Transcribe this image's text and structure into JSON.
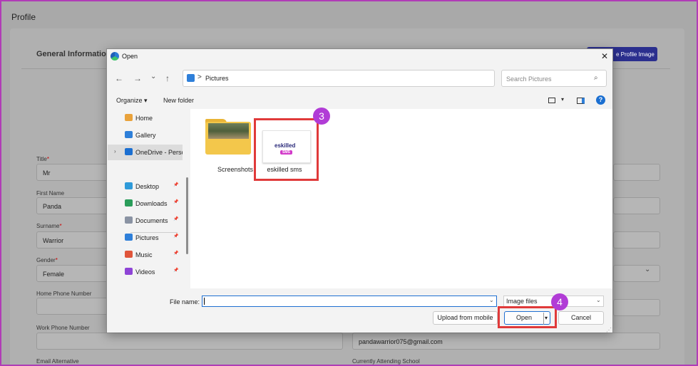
{
  "page": {
    "title": "Profile",
    "section_title": "General Information",
    "upload_button": "e Profile Image",
    "fields": {
      "title_label": "Title",
      "title_value": "Mr",
      "first_name_label": "First Name",
      "first_name_value": "Panda",
      "surname_label": "Surname",
      "surname_value": "Warrior",
      "gender_label": "Gender",
      "gender_value": "Female",
      "home_phone_label": "Home Phone Number",
      "work_phone_label": "Work Phone Number",
      "email_value": "pandawarrior075@gmail.com",
      "email_alt_label": "Email Alternative",
      "school_label": "Currently Attending School"
    },
    "required_mark": "*"
  },
  "dialog": {
    "title": "Open",
    "address": {
      "separator": ">",
      "location": "Pictures"
    },
    "search_placeholder": "Search Pictures",
    "toolbar": {
      "organize": "Organize ▾",
      "new_folder": "New folder"
    },
    "sidebar": [
      {
        "label": "Home",
        "icon": "home-icon",
        "color": "#e9a23b",
        "pinned": false
      },
      {
        "label": "Gallery",
        "icon": "gallery-icon",
        "color": "#2e7fd9",
        "pinned": false
      },
      {
        "label": "OneDrive - Perso",
        "icon": "cloud-icon",
        "color": "#1b6fd1",
        "pinned": false,
        "selected": true
      },
      {
        "label": "Desktop",
        "icon": "desktop-icon",
        "color": "#2e9ad9",
        "pinned": true
      },
      {
        "label": "Downloads",
        "icon": "download-icon",
        "color": "#2a9d5a",
        "pinned": true
      },
      {
        "label": "Documents",
        "icon": "document-icon",
        "color": "#8a93a3",
        "pinned": true
      },
      {
        "label": "Pictures",
        "icon": "pictures-icon",
        "color": "#2e7fd9",
        "pinned": true
      },
      {
        "label": "Music",
        "icon": "music-icon",
        "color": "#e0553a",
        "pinned": true
      },
      {
        "label": "Videos",
        "icon": "video-icon",
        "color": "#8e44d6",
        "pinned": true
      }
    ],
    "files": [
      {
        "label": "Screenshots",
        "type": "folder"
      },
      {
        "label": "eskilled sms",
        "type": "image"
      }
    ],
    "thumb_logo": {
      "line1": "eskilled",
      "line2": "SMS"
    },
    "file_name_label": "File name:",
    "file_name_value": "",
    "file_type": "Image files",
    "buttons": {
      "upload_mobile": "Upload from mobile",
      "open": "Open",
      "cancel": "Cancel"
    }
  },
  "annotations": {
    "step3": "3",
    "step4": "4"
  },
  "colors": {
    "accent": "#1f6fd1",
    "highlight": "#e03a3a",
    "badge": "#b13cd6",
    "frame": "#b13cb6"
  }
}
